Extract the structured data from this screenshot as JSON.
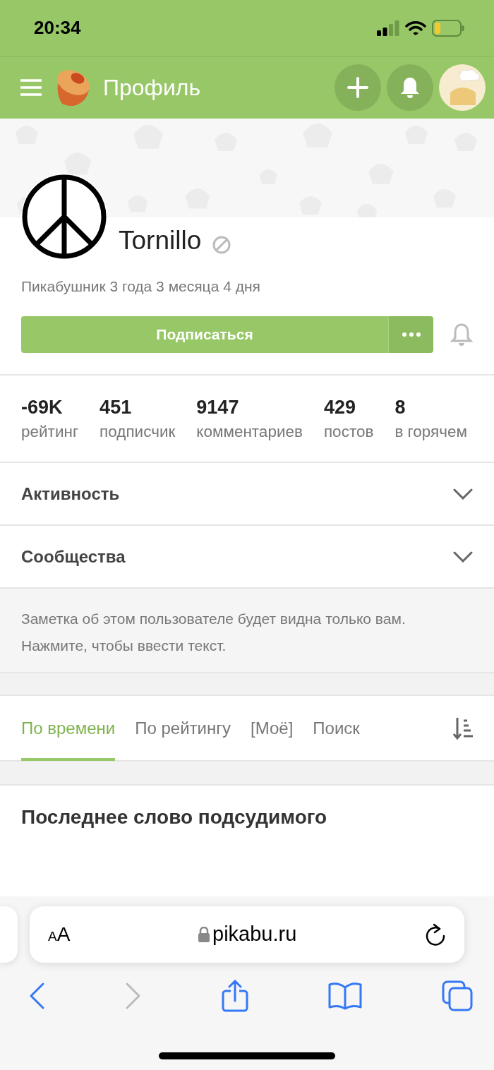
{
  "status_bar": {
    "time": "20:34"
  },
  "header": {
    "title": "Профиль"
  },
  "profile": {
    "username": "Tornillo",
    "tenure": "Пикабушник 3 года 3 месяца 4 дня",
    "subscribe_button": "Подписаться"
  },
  "stats": [
    {
      "value": "-69K",
      "label": "рейтинг"
    },
    {
      "value": "451",
      "label": "подписчик"
    },
    {
      "value": "9147",
      "label": "комментариев"
    },
    {
      "value": "429",
      "label": "постов"
    },
    {
      "value": "8",
      "label": "в горячем"
    }
  ],
  "sections": [
    {
      "title": "Активность",
      "expanded": false
    },
    {
      "title": "Сообщества",
      "expanded": false
    }
  ],
  "note": {
    "placeholder": "Заметка об этом пользователе будет видна только вам. Нажмите, чтобы ввести текст."
  },
  "tabs": [
    {
      "label": "По времени",
      "selected": true
    },
    {
      "label": "По рейтингу",
      "selected": false
    },
    {
      "label": "[Моё]",
      "selected": false
    },
    {
      "label": "Поиск",
      "selected": false
    }
  ],
  "post": {
    "title": "Последнее слово подсудимого"
  },
  "browser": {
    "text_size_button": "AA",
    "url": "pikabu.ru"
  }
}
